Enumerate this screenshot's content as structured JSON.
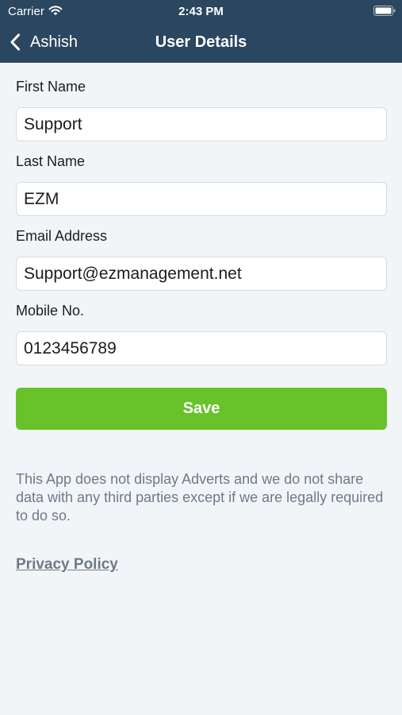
{
  "status_bar": {
    "carrier": "Carrier",
    "time": "2:43 PM",
    "wifi_icon": "wifi-icon",
    "battery_icon": "battery-full-icon"
  },
  "nav": {
    "back_label": "Ashish",
    "back_icon": "chevron-left-icon",
    "title": "User Details"
  },
  "form": {
    "first_name": {
      "label": "First Name",
      "value": "Support"
    },
    "last_name": {
      "label": "Last Name",
      "value": "EZM"
    },
    "email": {
      "label": "Email Address",
      "value": "Support@ezmanagement.net"
    },
    "mobile": {
      "label": "Mobile No.",
      "value": "0123456789"
    }
  },
  "save_label": "Save",
  "disclaimer": "This App does not display Adverts and we do not share data with any third parties except if we are legally required to do so.",
  "privacy_link": "Privacy Policy",
  "colors": {
    "header": "#2b4760",
    "background": "#f2f5f8",
    "save_button": "#68c22a",
    "muted_text": "#6e7a86"
  }
}
